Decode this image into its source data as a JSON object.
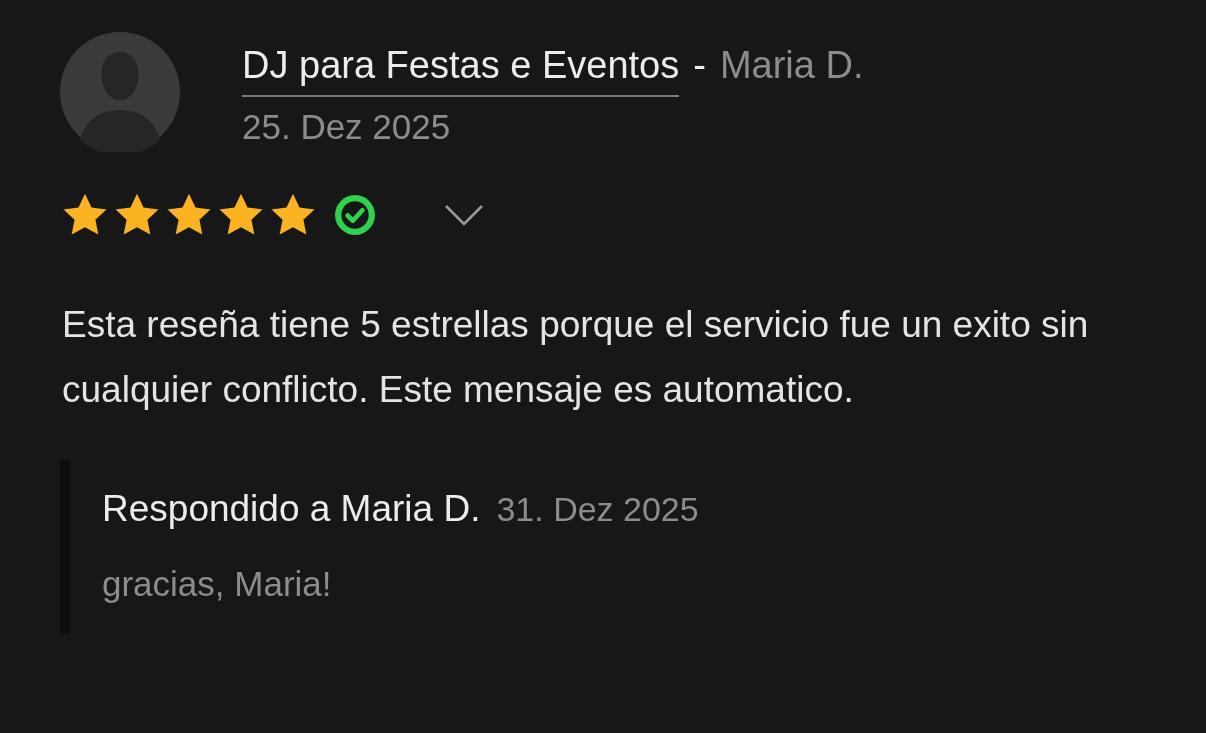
{
  "review": {
    "title": "DJ para Festas e Eventos",
    "separator": "-",
    "author": "Maria D.",
    "date": "25. Dez 2025",
    "stars": 5,
    "verified": true,
    "body": "Esta reseña tiene 5 estrellas porque el servicio fue un exito sin cualquier conflicto. Este mensaje es automatico.",
    "reply": {
      "heading": "Respondido a Maria D.",
      "date": "31. Dez 2025",
      "text": "gracias, Maria!"
    }
  }
}
